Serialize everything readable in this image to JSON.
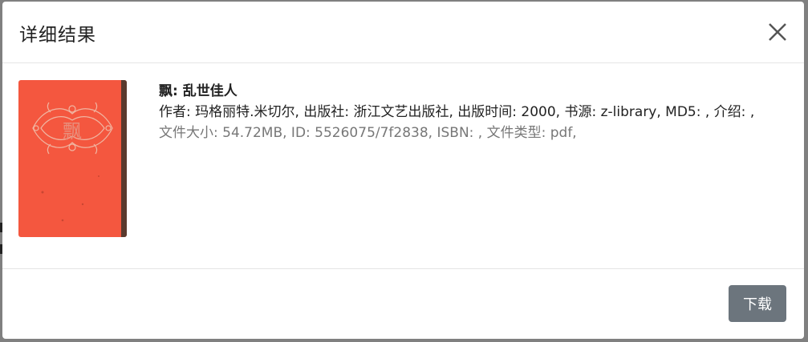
{
  "modal": {
    "title": "详细结果",
    "close_icon": "close-icon"
  },
  "book": {
    "title": "飘: 乱世佳人",
    "details_line": "作者: 玛格丽特.米切尔, 出版社: 浙江文艺出版社, 出版时间: 2000, 书源: z-library, MD5: , 介绍: ,",
    "meta_line": "文件大小: 54.72MB, ID: 5526075/7f2838, ISBN: , 文件类型: pdf,",
    "cover_text": "飘",
    "cover_color": "#f4573f"
  },
  "footer": {
    "download_label": "下载",
    "download_color": "#6c757d"
  }
}
